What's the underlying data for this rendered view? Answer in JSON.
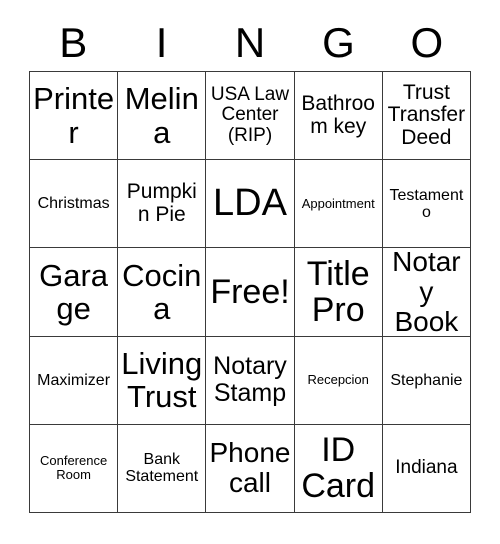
{
  "card": {
    "header_letters": [
      "B",
      "I",
      "N",
      "G",
      "O"
    ],
    "rows": [
      [
        {
          "text": "Printer",
          "size": "fs-2xl"
        },
        {
          "text": "Melina",
          "size": "fs-2xl"
        },
        {
          "text": "USA Law Center (RIP)",
          "size": "fs-m"
        },
        {
          "text": "Bathroom key",
          "size": "fs-ml"
        },
        {
          "text": "Trust Transfer Deed",
          "size": "fs-ml"
        }
      ],
      [
        {
          "text": "Christmas",
          "size": "fs-s"
        },
        {
          "text": "Pumpkin Pie",
          "size": "fs-ml"
        },
        {
          "text": "LDA",
          "size": "fs-4xl"
        },
        {
          "text": "Appointment",
          "size": "fs-xs"
        },
        {
          "text": "Testamento",
          "size": "fs-s"
        }
      ],
      [
        {
          "text": "Garage",
          "size": "fs-2xl"
        },
        {
          "text": "Cocina",
          "size": "fs-2xl"
        },
        {
          "text": "Free!",
          "size": "fs-3xl"
        },
        {
          "text": "Title Pro",
          "size": "fs-3xl"
        },
        {
          "text": "Notary Book",
          "size": "fs-xl"
        }
      ],
      [
        {
          "text": "Maximizer",
          "size": "fs-s"
        },
        {
          "text": "Living Trust",
          "size": "fs-2xl"
        },
        {
          "text": "Notary Stamp",
          "size": "fs-l"
        },
        {
          "text": "Recepcion",
          "size": "fs-xs"
        },
        {
          "text": "Stephanie",
          "size": "fs-s"
        }
      ],
      [
        {
          "text": "Conference Room",
          "size": "fs-xs"
        },
        {
          "text": "Bank Statement",
          "size": "fs-s"
        },
        {
          "text": "Phone call",
          "size": "fs-xl"
        },
        {
          "text": "ID Card",
          "size": "fs-3xl"
        },
        {
          "text": "Indiana",
          "size": "fs-m"
        }
      ]
    ],
    "free_space": {
      "row": 2,
      "col": 2,
      "label": "Free!"
    },
    "colors": {
      "background": "#ffffff",
      "text": "#000000",
      "grid_line": "#3a3a3a"
    }
  }
}
